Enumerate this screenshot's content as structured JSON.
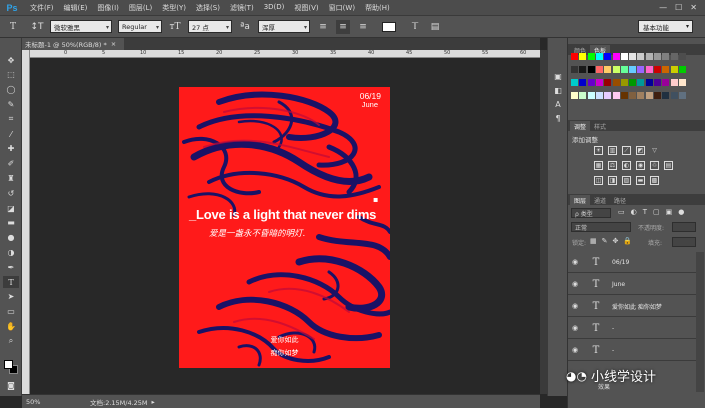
{
  "app": {
    "logo": "Ps"
  },
  "menu": [
    "文件(F)",
    "编辑(E)",
    "图像(I)",
    "图层(L)",
    "类型(Y)",
    "选择(S)",
    "滤镜(T)",
    "3D(D)",
    "视图(V)",
    "窗口(W)",
    "帮助(H)"
  ],
  "window_controls": [
    "—",
    "☐",
    "✕"
  ],
  "options_bar": {
    "font_family": "微软雅黑",
    "font_style": "Regular",
    "font_size": "27 点",
    "antialias": "浑厚",
    "color_swatch": "#ffffff",
    "workspace": "基本功能"
  },
  "document_tab": {
    "title": "未标题-1 @ 50%(RGB/8) *",
    "close": "×"
  },
  "ruler_labels": [
    "0",
    "5",
    "10",
    "15",
    "20",
    "25",
    "30",
    "35",
    "40",
    "45",
    "50",
    "55",
    "60"
  ],
  "status": {
    "zoom": "50%",
    "doc_info": "文档:2.15M/4.25M"
  },
  "poster": {
    "background": "#ff1a1a",
    "wave_color": "#1a1266",
    "date": "06/19",
    "month": "June",
    "mark": "▪",
    "headline": "_Love is a light that never dims",
    "subline": "爱是一盏永不昏暗的明灯.",
    "bottom_line1": "爱你如此",
    "bottom_line2": "痴你如梦"
  },
  "panels": {
    "color_tabs": [
      "颜色",
      "色板"
    ],
    "adjust_tabs": [
      "调整",
      "样式"
    ],
    "adjust_title": "添加调整",
    "layer_tabs": [
      "图层",
      "通道",
      "路径"
    ],
    "layer_filter": "ρ 类型",
    "blend_mode": "正常",
    "opacity_label": "不透明度:",
    "lock_label": "锁定:",
    "fill_label": "填充:",
    "layers": [
      {
        "icon": "T",
        "name": "06/19"
      },
      {
        "icon": "T",
        "name": "June"
      },
      {
        "icon": "T",
        "name": "爱你如此 痴你如梦"
      },
      {
        "icon": "T",
        "name": "-"
      },
      {
        "icon": "T",
        "name": "-"
      }
    ],
    "effects_label": "效果"
  },
  "watermark": "小线学设计",
  "swatch_colors": [
    "#ff0000",
    "#ffff00",
    "#00ff00",
    "#00ffff",
    "#0000ff",
    "#ff00ff",
    "#ffffff",
    "#e6e6e6",
    "#cccccc",
    "#b3b3b3",
    "#999999",
    "#808080",
    "#666666",
    "#4d4d4d",
    "#333333",
    "#1a1a1a",
    "#000000",
    "#ff6666",
    "#ffcc66",
    "#ccff66",
    "#66ff99",
    "#66ccff",
    "#9966ff",
    "#ff66cc",
    "#cc0000",
    "#cc6600",
    "#cccc00",
    "#00cc00",
    "#00cccc",
    "#0000cc",
    "#6600cc",
    "#cc00cc",
    "#990000",
    "#994d00",
    "#999900",
    "#009900",
    "#009999",
    "#000099",
    "#4d0099",
    "#990099",
    "#ffcccc",
    "#ffe6cc",
    "#ffffcc",
    "#ccffcc",
    "#ccffff",
    "#cce0ff",
    "#e6ccff",
    "#ffccf2",
    "#663300",
    "#806040",
    "#a08060",
    "#c0a080",
    "#402010",
    "#203040",
    "#405060",
    "#607080"
  ]
}
